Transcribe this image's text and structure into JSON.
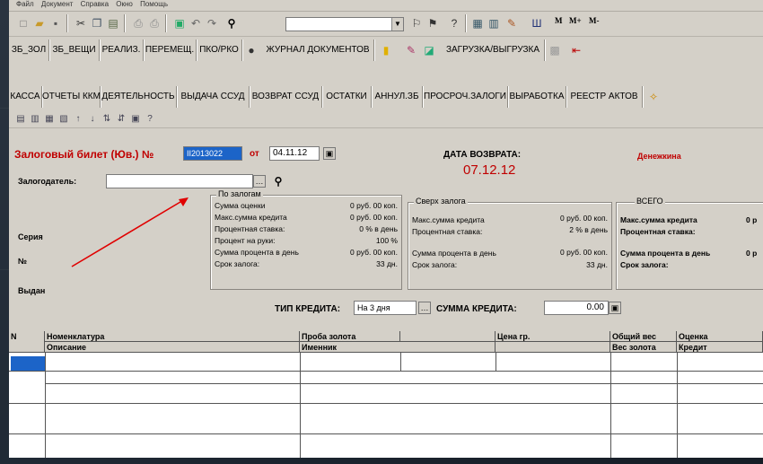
{
  "menu": [
    "Файл",
    "Документ",
    "Справка",
    "Окно",
    "Помощь"
  ],
  "toolbar_top": {
    "search_value": "",
    "m_buttons": [
      "M",
      "M+",
      "M-"
    ]
  },
  "nav_row": [
    "ЗБ_ЗОЛ",
    "ЗБ_ВЕЩИ",
    "РЕАЛИЗ.",
    "ПЕРЕМЕЩ.",
    "ПКО/РКО",
    "ЖУРНАЛ ДОКУМЕНТОВ",
    "ЗАГРУЗКА/ВЫГРУЗКА"
  ],
  "tabs": [
    "КАССА",
    "ОТЧЕТЫ ККМ",
    "ДЕЯТЕЛЬНОСТЬ",
    "ВЫДАЧА ССУД",
    "ВОЗВРАТ ССУД",
    "ОСТАТКИ",
    "АННУЛ.ЗБ",
    "ПРОСРОЧ.ЗАЛОГИ",
    "ВЫРАБОТКА",
    "РЕЕСТР АКТОВ"
  ],
  "form": {
    "title": "Залоговый билет (Юв.) №",
    "ticket_number": "II2013022",
    "from_label": "от",
    "date": "04.11.12",
    "return_label": "ДАТА ВОЗВРАТА:",
    "return_date": "07.12.12",
    "cashier": "Денежкина",
    "pledger_label": "Залогодатель:",
    "pledger_value": "",
    "series_label": "Серия",
    "number_label": "№",
    "issued_label": "Выдан",
    "credit_type_label": "ТИП КРЕДИТА:",
    "credit_type_value": "На 3 дня",
    "credit_sum_label": "СУММА КРЕДИТА:",
    "credit_sum_value": "0.00"
  },
  "group_pledges": {
    "title": "По залогам",
    "rows": [
      {
        "label": "Сумма оценки",
        "value": "0 руб. 00 коп."
      },
      {
        "label": "Макс.сумма кредита",
        "value": "0 руб. 00 коп."
      },
      {
        "label": "Процентная ставка:",
        "value": "0 % в день"
      },
      {
        "label": "Процент на руки:",
        "value": "100 %"
      },
      {
        "label": "Сумма процента в день",
        "value": "0 руб. 00 коп."
      },
      {
        "label": "Срок залога:",
        "value": "33 дн."
      }
    ]
  },
  "group_over": {
    "title": "Сверх залога",
    "rows": [
      {
        "label": "Макс.сумма кредита",
        "value": "0 руб. 00 коп."
      },
      {
        "label": "Процентная ставка:",
        "value": "2 % в день"
      },
      {
        "label": "Сумма процента в день",
        "value": "0 руб. 00 коп."
      },
      {
        "label": "Срок залога:",
        "value": "33 дн."
      }
    ]
  },
  "group_total": {
    "title": "ВСЕГО",
    "rows": [
      {
        "label": "Макс.сумма кредита",
        "value": "0 р"
      },
      {
        "label": "Процентная ставка:",
        "value": ""
      },
      {
        "label": "Сумма процента в день",
        "value": "0 р"
      },
      {
        "label": "Срок залога:",
        "value": ""
      }
    ]
  },
  "grid": {
    "headers_top": [
      "N",
      "Номенклатура",
      "Проба золота",
      "",
      "Цена гр.",
      "Общий вес",
      "Оценка"
    ],
    "headers_bottom": [
      "",
      "Описание",
      "Именник",
      "",
      "",
      "Вес золота",
      "Кредит"
    ]
  },
  "colors": {
    "accent_red": "#c00000",
    "selection": "#1c64c8",
    "arrow": "#e00000"
  }
}
